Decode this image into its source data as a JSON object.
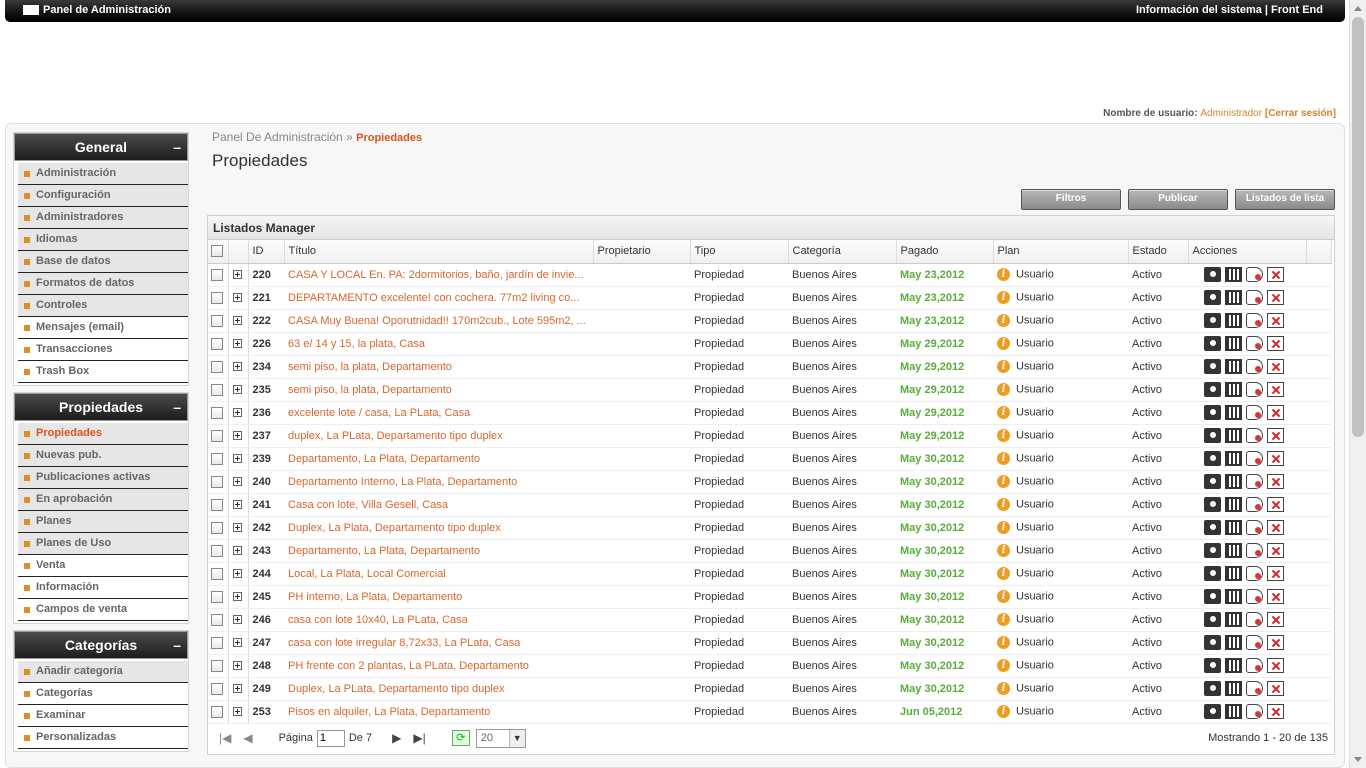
{
  "topbar": {
    "title": "Panel de Administración",
    "links": "Información del sistema | Front End"
  },
  "user": {
    "label": "Nombre de usuario:",
    "name": "Administrador",
    "logout": "[Cerrar sesión]"
  },
  "sidebar": {
    "general": {
      "title": "General",
      "items": [
        "Administración",
        "Configuración",
        "Administradores",
        "Idiomas",
        "Base de datos",
        "Formatos de datos",
        "Controles",
        "Mensajes (email)",
        "Transacciones",
        "Trash Box"
      ]
    },
    "propiedades": {
      "title": "Propiedades",
      "items": [
        "Propiedades",
        "Nuevas pub.",
        "Publicaciones activas",
        "En aprobación",
        "Planes",
        "Planes de Uso",
        "Venta",
        "Información",
        "Campos de venta"
      ]
    },
    "categorias": {
      "title": "Categorías",
      "items": [
        "Añadir categoría",
        "Categorías",
        "Examinar",
        "Personalizadas"
      ]
    }
  },
  "breadcrumb": {
    "root": "Panel De Administración",
    "sep": "»",
    "current": "Propiedades"
  },
  "page_title": "Propiedades",
  "buttons": {
    "filters": "Filtros",
    "publish": "Publicar",
    "lists": "Listados de lista"
  },
  "grid": {
    "caption": "Listados Manager",
    "columns": [
      "ID",
      "Título",
      "Propietario",
      "Tipo",
      "Categoría",
      "Pagado",
      "Plan",
      "Estado",
      "Acciones"
    ],
    "rows": [
      {
        "id": "220",
        "title": "CASA Y LOCAL En. PA: 2dormitorios, baño, jardín de invie...",
        "owner": "",
        "type": "Propiedad",
        "category": "Buenos Aires",
        "paid": "May 23,2012",
        "plan": "Usuario",
        "status": "Activo"
      },
      {
        "id": "221",
        "title": "DEPARTAMENTO excelente! con cochera. 77m2 living co...",
        "owner": "",
        "type": "Propiedad",
        "category": "Buenos Aires",
        "paid": "May 23,2012",
        "plan": "Usuario",
        "status": "Activo"
      },
      {
        "id": "222",
        "title": "CASA Muy Buena! Oporutnidad!! 170m2cub., Lote 595m2, ...",
        "owner": "",
        "type": "Propiedad",
        "category": "Buenos Aires",
        "paid": "May 23,2012",
        "plan": "Usuario",
        "status": "Activo"
      },
      {
        "id": "226",
        "title": "63 e/ 14 y 15, la plata, Casa",
        "owner": "",
        "type": "Propiedad",
        "category": "Buenos Aires",
        "paid": "May 29,2012",
        "plan": "Usuario",
        "status": "Activo"
      },
      {
        "id": "234",
        "title": "semi piso, la plata, Departamento",
        "owner": "",
        "type": "Propiedad",
        "category": "Buenos Aires",
        "paid": "May 29,2012",
        "plan": "Usuario",
        "status": "Activo"
      },
      {
        "id": "235",
        "title": "semi piso, la plata, Departamento",
        "owner": "",
        "type": "Propiedad",
        "category": "Buenos Aires",
        "paid": "May 29,2012",
        "plan": "Usuario",
        "status": "Activo"
      },
      {
        "id": "236",
        "title": "excelente lote / casa, La PLata, Casa",
        "owner": "",
        "type": "Propiedad",
        "category": "Buenos Aires",
        "paid": "May 29,2012",
        "plan": "Usuario",
        "status": "Activo"
      },
      {
        "id": "237",
        "title": "duplex, La PLata, Departamento tipo duplex",
        "owner": "",
        "type": "Propiedad",
        "category": "Buenos Aires",
        "paid": "May 29,2012",
        "plan": "Usuario",
        "status": "Activo"
      },
      {
        "id": "239",
        "title": "Departamento, La Plata, Departamento",
        "owner": "",
        "type": "Propiedad",
        "category": "Buenos Aires",
        "paid": "May 30,2012",
        "plan": "Usuario",
        "status": "Activo"
      },
      {
        "id": "240",
        "title": "Departamento Interno, La Plata, Departamento",
        "owner": "",
        "type": "Propiedad",
        "category": "Buenos Aires",
        "paid": "May 30,2012",
        "plan": "Usuario",
        "status": "Activo"
      },
      {
        "id": "241",
        "title": "Casa con lote, Villa Gesell, Casa",
        "owner": "",
        "type": "Propiedad",
        "category": "Buenos Aires",
        "paid": "May 30,2012",
        "plan": "Usuario",
        "status": "Activo"
      },
      {
        "id": "242",
        "title": "Duplex, La Plata, Departamento tipo duplex",
        "owner": "",
        "type": "Propiedad",
        "category": "Buenos Aires",
        "paid": "May 30,2012",
        "plan": "Usuario",
        "status": "Activo"
      },
      {
        "id": "243",
        "title": "Departamento, La Plata, Departamento",
        "owner": "",
        "type": "Propiedad",
        "category": "Buenos Aires",
        "paid": "May 30,2012",
        "plan": "Usuario",
        "status": "Activo"
      },
      {
        "id": "244",
        "title": "Local, La Plata, Local Comercial",
        "owner": "",
        "type": "Propiedad",
        "category": "Buenos Aires",
        "paid": "May 30,2012",
        "plan": "Usuario",
        "status": "Activo"
      },
      {
        "id": "245",
        "title": "PH interno, La Plata, Departamento",
        "owner": "",
        "type": "Propiedad",
        "category": "Buenos Aires",
        "paid": "May 30,2012",
        "plan": "Usuario",
        "status": "Activo"
      },
      {
        "id": "246",
        "title": "casa con lote 10x40, La PLata, Casa",
        "owner": "",
        "type": "Propiedad",
        "category": "Buenos Aires",
        "paid": "May 30,2012",
        "plan": "Usuario",
        "status": "Activo"
      },
      {
        "id": "247",
        "title": "casa con lote irregular 8,72x33, La PLata, Casa",
        "owner": "",
        "type": "Propiedad",
        "category": "Buenos Aires",
        "paid": "May 30,2012",
        "plan": "Usuario",
        "status": "Activo"
      },
      {
        "id": "248",
        "title": "PH frente con 2 plantas, La PLata, Departamento",
        "owner": "",
        "type": "Propiedad",
        "category": "Buenos Aires",
        "paid": "May 30,2012",
        "plan": "Usuario",
        "status": "Activo"
      },
      {
        "id": "249",
        "title": "Duplex, La PLata, Departamento tipo duplex",
        "owner": "",
        "type": "Propiedad",
        "category": "Buenos Aires",
        "paid": "May 30,2012",
        "plan": "Usuario",
        "status": "Activo"
      },
      {
        "id": "253",
        "title": "Pisos en alquiler, La Plata, Departamento",
        "owner": "",
        "type": "Propiedad",
        "category": "Buenos Aires",
        "paid": "Jun 05,2012",
        "plan": "Usuario",
        "status": "Activo"
      }
    ],
    "action_icons": [
      "camera-icon",
      "film-icon",
      "tag-icon",
      "delete-icon"
    ]
  },
  "pager": {
    "page_label": "Página",
    "page_value": "1",
    "of_label": "De 7",
    "page_size": "20",
    "status": "Mostrando 1 - 20 de 135"
  },
  "colors": {
    "accent": "#d9662c",
    "paid_green": "#5aad3a",
    "bullet": "#e08c28",
    "header_dark": "#1d1d1d"
  }
}
